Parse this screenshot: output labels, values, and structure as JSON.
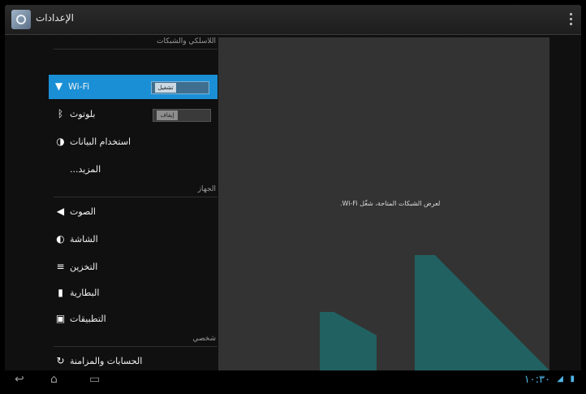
{
  "window": {
    "title": "الإعدادات",
    "action_bar_text": ""
  },
  "sections": {
    "wireless": "اللاسلكي والشبكات",
    "device": "الجهاز",
    "personal": "شخصي"
  },
  "items": [
    {
      "label": "Wi-Fi",
      "icon": "wifi-icon",
      "toggle": "تشغيل",
      "selected": true
    },
    {
      "label": "بلوتوث",
      "icon": "bluetooth-icon",
      "toggle": "إيقاف"
    },
    {
      "label": "استخدام البيانات",
      "icon": "data-usage-icon"
    },
    {
      "label": "المزيد..."
    },
    {
      "label": "الصوت",
      "icon": "sound-icon"
    },
    {
      "label": "الشاشة",
      "icon": "display-icon"
    },
    {
      "label": "التخزين",
      "icon": "storage-icon"
    },
    {
      "label": "البطارية",
      "icon": "battery-icon"
    },
    {
      "label": "التطبيقات",
      "icon": "apps-icon"
    },
    {
      "label": "الحسابات والمزامنة",
      "icon": "sync-icon"
    }
  ],
  "detail": {
    "message": "لعرض الشبكات المتاحة، شغّل Wi-Fi."
  },
  "status": {
    "clock": "١٠:٣٠"
  },
  "colors": {
    "accent": "#1a8fd6",
    "clock": "#4fb6e6"
  }
}
